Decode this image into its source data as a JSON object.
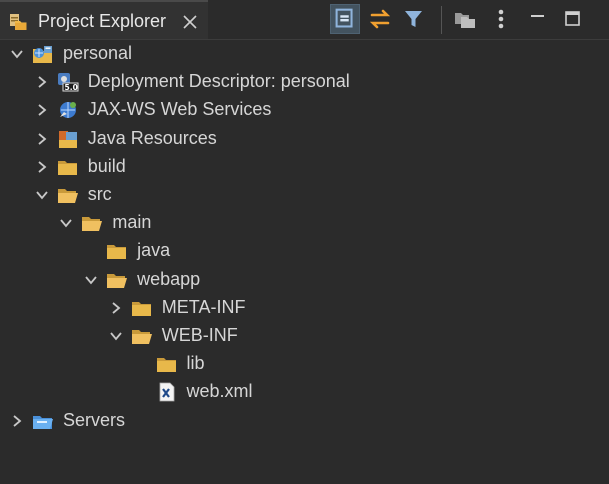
{
  "view": {
    "tab_title": "Project Explorer",
    "toolbar": [
      {
        "name": "collapse-all",
        "icon": "collapse-all-icon",
        "pressed": true
      },
      {
        "name": "link-with-editor",
        "icon": "link-with-editor-icon",
        "pressed": false
      },
      {
        "name": "filters",
        "icon": "filter-icon",
        "pressed": false
      },
      {
        "name": "select-working-set",
        "icon": "working-set-icon",
        "pressed": false
      },
      {
        "name": "view-menu",
        "icon": "view-menu-icon",
        "pressed": false
      },
      {
        "name": "minimize",
        "icon": "minimize-icon",
        "pressed": false
      },
      {
        "name": "maximize",
        "icon": "maximize-icon",
        "pressed": false
      }
    ]
  },
  "tree": [
    {
      "label": "personal",
      "icon": "web-project-icon",
      "chevron": "expanded",
      "depth": 0
    },
    {
      "label": "Deployment Descriptor: personal",
      "icon": "deployment-descriptor-icon",
      "chevron": "collapsed",
      "depth": 1
    },
    {
      "label": "JAX-WS Web Services",
      "icon": "web-services-icon",
      "chevron": "collapsed",
      "depth": 1
    },
    {
      "label": "Java Resources",
      "icon": "java-resources-icon",
      "chevron": "collapsed",
      "depth": 1
    },
    {
      "label": "build",
      "icon": "folder-icon",
      "chevron": "collapsed",
      "depth": 1
    },
    {
      "label": "src",
      "icon": "folder-open-icon",
      "chevron": "expanded",
      "depth": 1
    },
    {
      "label": "main",
      "icon": "folder-open-icon",
      "chevron": "expanded",
      "depth": 2
    },
    {
      "label": "java",
      "icon": "folder-icon",
      "chevron": "none",
      "depth": 3
    },
    {
      "label": "webapp",
      "icon": "folder-open-icon",
      "chevron": "expanded",
      "depth": 3
    },
    {
      "label": "META-INF",
      "icon": "folder-icon",
      "chevron": "collapsed",
      "depth": 4
    },
    {
      "label": "WEB-INF",
      "icon": "folder-open-icon",
      "chevron": "expanded",
      "depth": 4
    },
    {
      "label": "lib",
      "icon": "folder-icon",
      "chevron": "none",
      "depth": 5
    },
    {
      "label": "web.xml",
      "icon": "xml-file-icon",
      "chevron": "none",
      "depth": 5
    },
    {
      "label": "Servers",
      "icon": "servers-folder-icon",
      "chevron": "collapsed",
      "depth": 0
    }
  ],
  "colors": {
    "background": "#2b2b2b",
    "text": "#d6d6d6",
    "folder": "#e8b84a",
    "accent_orange": "#f0a030",
    "toolbar_blue": "#8fb4dc"
  }
}
